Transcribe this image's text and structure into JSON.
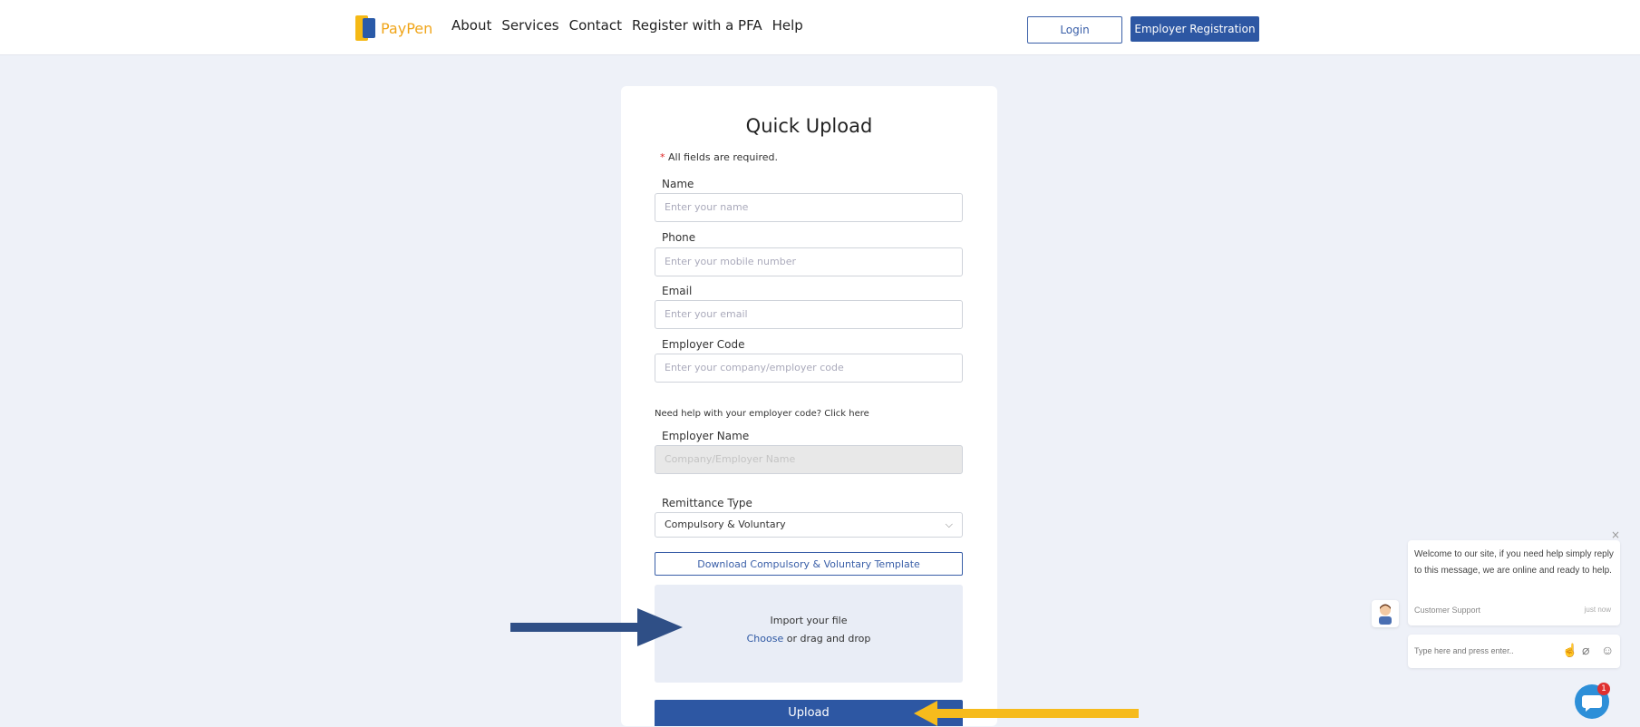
{
  "header": {
    "brand": "PayPen",
    "nav": [
      "About",
      "Services",
      "Contact",
      "Register with a PFA",
      "Help"
    ],
    "login_label": "Login",
    "employer_registration_label": "Employer Registration"
  },
  "form": {
    "title": "Quick Upload",
    "required_note": "All fields are required.",
    "required_marker": "*",
    "name_label": "Name",
    "name_placeholder": "Enter your name",
    "phone_label": "Phone",
    "phone_placeholder": "Enter your mobile number",
    "email_label": "Email",
    "email_placeholder": "Enter your email",
    "employer_code_label": "Employer Code",
    "employer_code_placeholder": "Enter your company/employer code",
    "employer_code_help": "Need help with your employer code?  Click here",
    "employer_name_label": "Employer Name",
    "employer_name_placeholder": "Company/Employer Name",
    "remittance_type_label": "Remittance Type",
    "remittance_type_value": "Compulsory & Voluntary",
    "download_template_label": "Download Compulsory & Voluntary Template",
    "dropzone_title": "Import your file",
    "dropzone_choose": "Choose",
    "dropzone_rest": " or drag and drop",
    "upload_label": "Upload"
  },
  "chat": {
    "close": "×",
    "message": "Welcome to our site, if you need help simply reply to this message, we are online and ready to help.",
    "agent": "Customer Support",
    "time": "just now",
    "input_placeholder": "Type here and press enter..",
    "badge_count": "1"
  },
  "colors": {
    "primary": "#2d57a3",
    "arrow_blue": "#2f4f86",
    "arrow_yellow": "#f6bb1c",
    "background": "#eef1f8"
  }
}
